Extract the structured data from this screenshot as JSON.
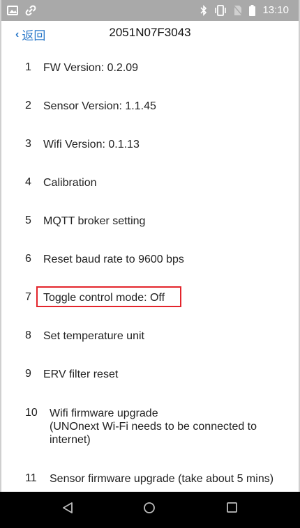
{
  "status_bar": {
    "time": "13:10"
  },
  "nav": {
    "back_label": "返回",
    "title": "2051N07F3043"
  },
  "menu": [
    {
      "num": "1",
      "label": "FW Version: 0.2.09"
    },
    {
      "num": "2",
      "label": "Sensor Version: 1.1.45"
    },
    {
      "num": "3",
      "label": "Wifi Version: 0.1.13"
    },
    {
      "num": "4",
      "label": "Calibration"
    },
    {
      "num": "5",
      "label": "MQTT broker setting"
    },
    {
      "num": "6",
      "label": "Reset baud rate to 9600 bps"
    },
    {
      "num": "7",
      "label": "Toggle control mode: Off"
    },
    {
      "num": "8",
      "label": "Set temperature unit"
    },
    {
      "num": "9",
      "label": "ERV filter reset"
    },
    {
      "num": "10",
      "label": "Wifi firmware upgrade\n(UNOnext Wi-Fi needs to be connected to internet)"
    },
    {
      "num": "11",
      "label": "Sensor firmware upgrade (take about 5 mins)"
    }
  ],
  "colors": {
    "status_bar": "#a9a9a9",
    "accent": "#2a78c9",
    "highlight": "#e3242b"
  }
}
